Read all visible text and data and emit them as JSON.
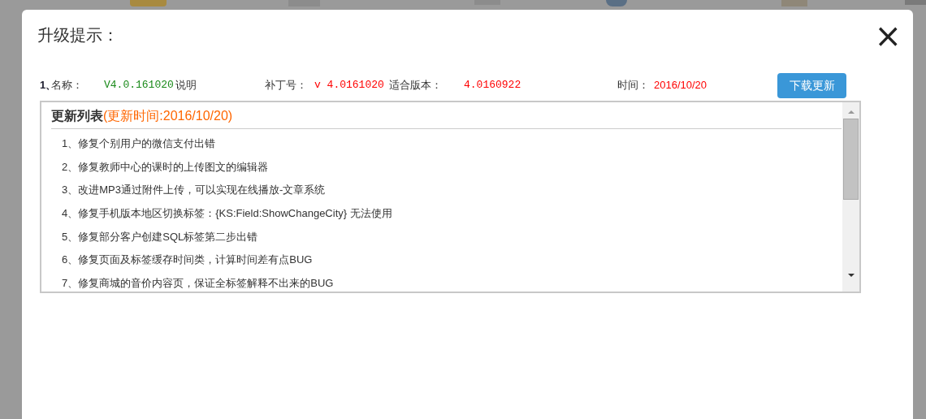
{
  "dialog": {
    "title": "升级提示：",
    "close": "×"
  },
  "patch": {
    "index": "1、",
    "name_label": "名称：",
    "name_value": "V4.0.161020",
    "note": "说明",
    "patch_label": "补丁号：",
    "patch_value": "v 4.0161020",
    "fit_label": "适合版本：",
    "fit_value": "4.0160922",
    "time_label": "时间：",
    "time_value": "2016/10/20",
    "button": "下载更新"
  },
  "changelog": {
    "title": "更新列表",
    "date": "(更新时间:2016/10/20)",
    "items": [
      "1、修复个别用户的微信支付出错",
      "2、修复教师中心的课时的上传图文的编辑器",
      "3、改进MP3通过附件上传，可以实现在线播放-文章系统",
      "4、修复手机版本地区切换标签：{KS:Field:ShowChangeCity} 无法使用",
      "5、修复部分客户创建SQL标签第二步出错",
      "6、修复页面及标签缓存时间类，计算时间差有点BUG",
      "7、修复商城的音价内容页，保证全标签解释不出来的BUG"
    ]
  }
}
